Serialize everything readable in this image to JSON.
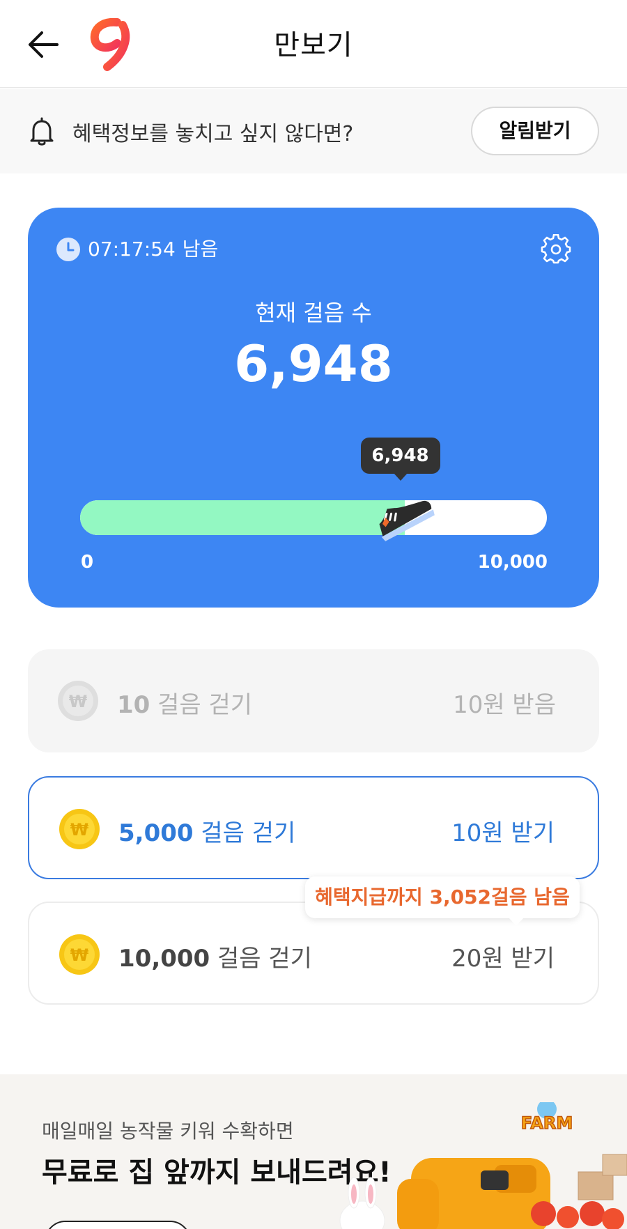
{
  "header": {
    "title": "만보기"
  },
  "notify": {
    "text": "혜택정보를 놓치고 싶지 않다면?",
    "button_label": "알림받기"
  },
  "card": {
    "timer": "07:17:54",
    "timer_suffix": "남음",
    "steps_label": "현재 걸음 수",
    "steps_value": "6,948",
    "bubble_value": "6,948",
    "progress_fraction": 0.6948,
    "min_label": "0",
    "max_label": "10,000"
  },
  "rewards": [
    {
      "steps": "10",
      "suffix": "걸음 걷기",
      "amount": "10원 받음",
      "state": "claimed"
    },
    {
      "steps": "5,000",
      "suffix": "걸음 걷기",
      "amount": "10원 받기",
      "state": "available"
    },
    {
      "steps": "10,000",
      "suffix": "걸음 걷기",
      "amount": "20원 받기",
      "state": "locked"
    }
  ],
  "tooltip": {
    "text": "혜택지급까지 3,052걸음 남음"
  },
  "banner": {
    "subtitle": "매일매일 농작물 키워 수확하면",
    "title": "무료로 집 앞까지 보내드려요!",
    "logo_text": "FARM"
  },
  "colors": {
    "card_blue": "#3d86f3",
    "progress_fill": "#93f8c2",
    "accent_blue": "#2f7ad8",
    "tooltip_orange": "#e8682f",
    "coin_yellow": "#f7c615"
  }
}
